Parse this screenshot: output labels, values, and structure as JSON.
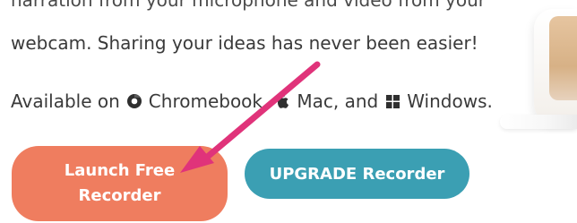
{
  "intro": {
    "cut_top_line": "narration from your microphone and video from your",
    "webcam_line": "webcam. Sharing your ideas has never been easier!",
    "available": {
      "prefix": "Available on",
      "chromebook": "Chromebook,",
      "mac": "Mac, and",
      "windows": "Windows."
    }
  },
  "buttons": {
    "launch": {
      "line1": "Launch Free",
      "line2": "Recorder",
      "color": "#ef7d5f"
    },
    "upgrade": {
      "label": "UPGRADE Recorder",
      "color": "#3b9fb3"
    }
  },
  "icons": {
    "chrome": "chrome-icon",
    "apple": "apple-icon",
    "windows": "windows-icon"
  },
  "annotation": {
    "arrow_color": "#e0337a"
  }
}
